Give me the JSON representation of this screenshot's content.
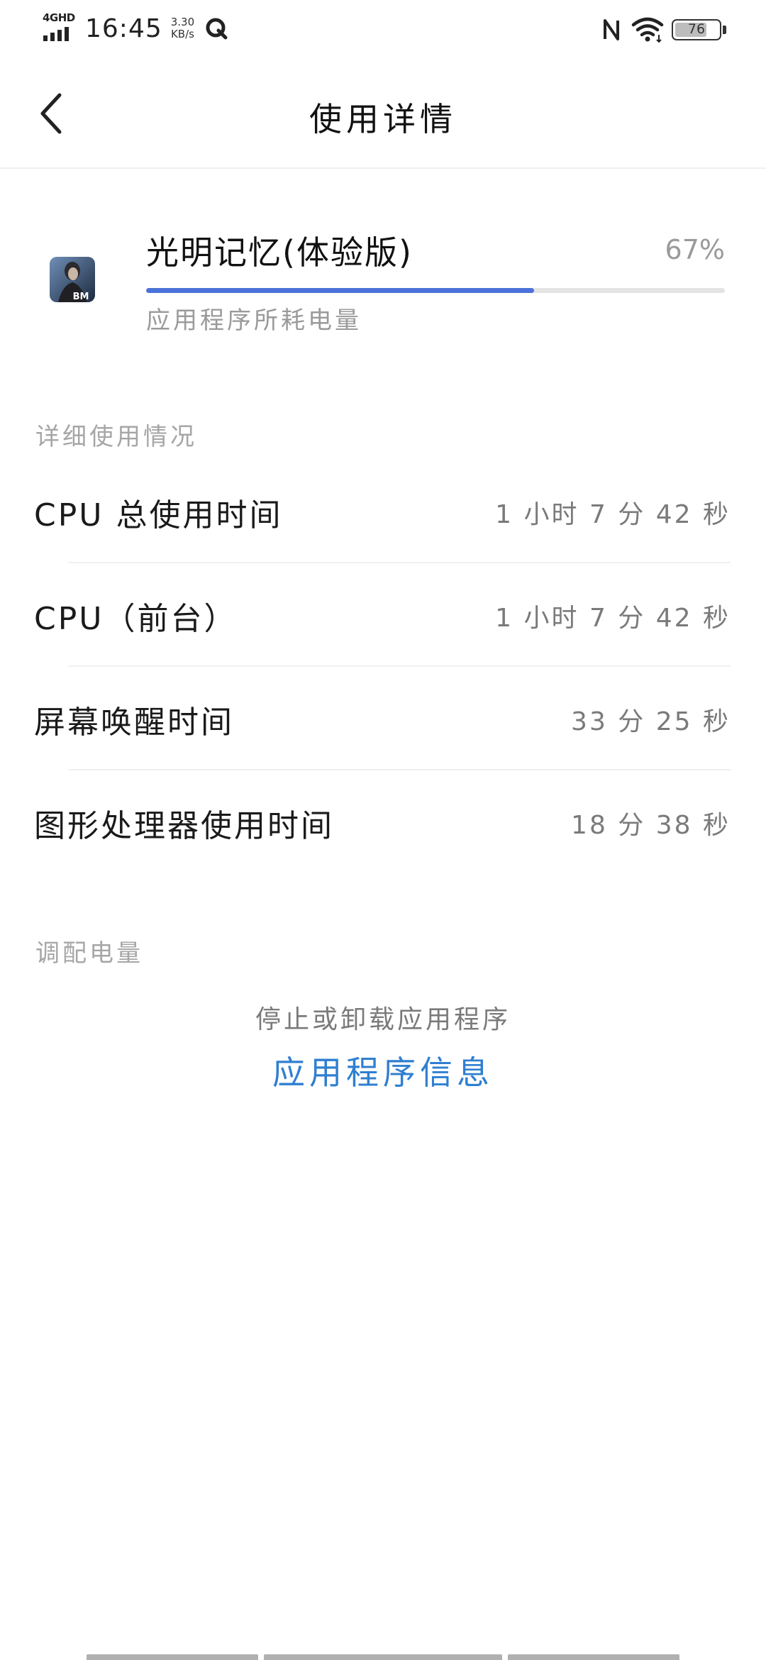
{
  "status_bar": {
    "network": "4GHD",
    "time": "16:45",
    "speed_value": "3.30",
    "speed_unit": "KB/s",
    "battery": "76",
    "battery_level": 0.76
  },
  "header": {
    "title": "使用详情"
  },
  "app": {
    "name": "光明记忆(体验版)",
    "percent": "67%",
    "usage_fraction": 0.67,
    "subtitle": "应用程序所耗电量",
    "icon_label": "BM",
    "accent_color": "#4a72d9"
  },
  "details": {
    "section_title": "详细使用情况",
    "rows": [
      {
        "label": "CPU 总使用时间",
        "value": "1 小时 7 分 42 秒"
      },
      {
        "label": "CPU（前台）",
        "value": "1 小时 7 分 42 秒"
      },
      {
        "label": "屏幕唤醒时间",
        "value": "33 分 25 秒"
      },
      {
        "label": "图形处理器使用时间",
        "value": "18 分 38 秒"
      }
    ]
  },
  "adjust": {
    "section_title": "调配电量",
    "stop_text": "停止或卸载应用程序",
    "link_label": "应用程序信息",
    "link_color": "#2f7fd0"
  }
}
